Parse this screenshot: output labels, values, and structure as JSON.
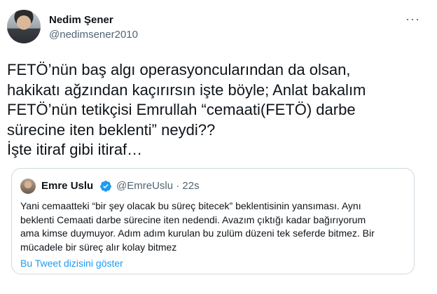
{
  "author": {
    "display_name": "Nedim Şener",
    "handle": "@nedimsener2010"
  },
  "more_label": "···",
  "tweet": {
    "lines": [
      "FETÖ’nün baş algı operasyoncularından da olsan,",
      "hakikatı ağzından kaçırırsın işte böyle; Anlat bakalım",
      "FETÖ’nün tetikçisi Emrullah “cemaati(FETÖ) darbe",
      "sürecine iten beklenti” neydi??",
      "İşte itiraf gibi itiraf…"
    ]
  },
  "quote": {
    "display_name": "Emre Uslu",
    "verified": true,
    "handle_time": "@EmreUslu · 22s",
    "lines": [
      "Yani cemaatteki “bir şey olacak bu süreç bitecek” beklentisinin yansıması. Aynı",
      "beklenti Cemaati darbe sürecine iten nedendi. Avazım çıktığı kadar bağırıyorum",
      "ama kimse duymuyor. Adım adım kurulan bu zulüm düzeni tek seferde bitmez. Bir",
      "mücadele bir süreç alır kolay bitmez"
    ],
    "show_thread_label": "Bu Tweet dizisini göster"
  },
  "colors": {
    "text": "#0f1419",
    "secondary": "#536471",
    "link": "#1d9bf0",
    "border": "#cfd9de"
  }
}
